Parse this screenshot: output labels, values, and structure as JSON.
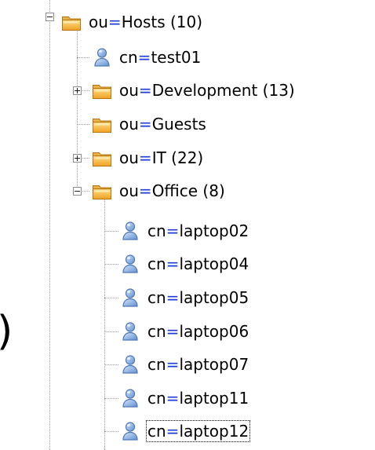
{
  "tree": {
    "root": {
      "prefix": "ou",
      "value": "Hosts (10)",
      "expanded": true,
      "icon": "folder-icon"
    },
    "children": [
      {
        "key": "test01",
        "prefix": "cn",
        "value": "test01",
        "icon": "user-icon"
      },
      {
        "key": "development",
        "prefix": "ou",
        "value": "Development (13)",
        "icon": "folder-icon",
        "expandable": true,
        "expanded": false
      },
      {
        "key": "guests",
        "prefix": "ou",
        "value": "Guests",
        "icon": "folder-icon"
      },
      {
        "key": "it",
        "prefix": "ou",
        "value": "IT (22)",
        "icon": "folder-icon",
        "expandable": true,
        "expanded": false
      },
      {
        "key": "office",
        "prefix": "ou",
        "value": "Office (8)",
        "icon": "folder-icon",
        "expandable": true,
        "expanded": true
      }
    ],
    "office_children": [
      {
        "key": "laptop02",
        "prefix": "cn",
        "value": "laptop02",
        "icon": "user-icon"
      },
      {
        "key": "laptop04",
        "prefix": "cn",
        "value": "laptop04",
        "icon": "user-icon"
      },
      {
        "key": "laptop05",
        "prefix": "cn",
        "value": "laptop05",
        "icon": "user-icon"
      },
      {
        "key": "laptop06",
        "prefix": "cn",
        "value": "laptop06",
        "icon": "user-icon"
      },
      {
        "key": "laptop07",
        "prefix": "cn",
        "value": "laptop07",
        "icon": "user-icon"
      },
      {
        "key": "laptop11",
        "prefix": "cn",
        "value": "laptop11",
        "icon": "user-icon"
      },
      {
        "key": "laptop12",
        "prefix": "cn",
        "value": "laptop12",
        "icon": "user-icon",
        "focused": true
      }
    ],
    "eq_sign": "=",
    "edge_glyph": ")"
  },
  "colors": {
    "eq": "#1d3bd6",
    "folder": "#f1a52e",
    "user": "#6f9bd6"
  }
}
